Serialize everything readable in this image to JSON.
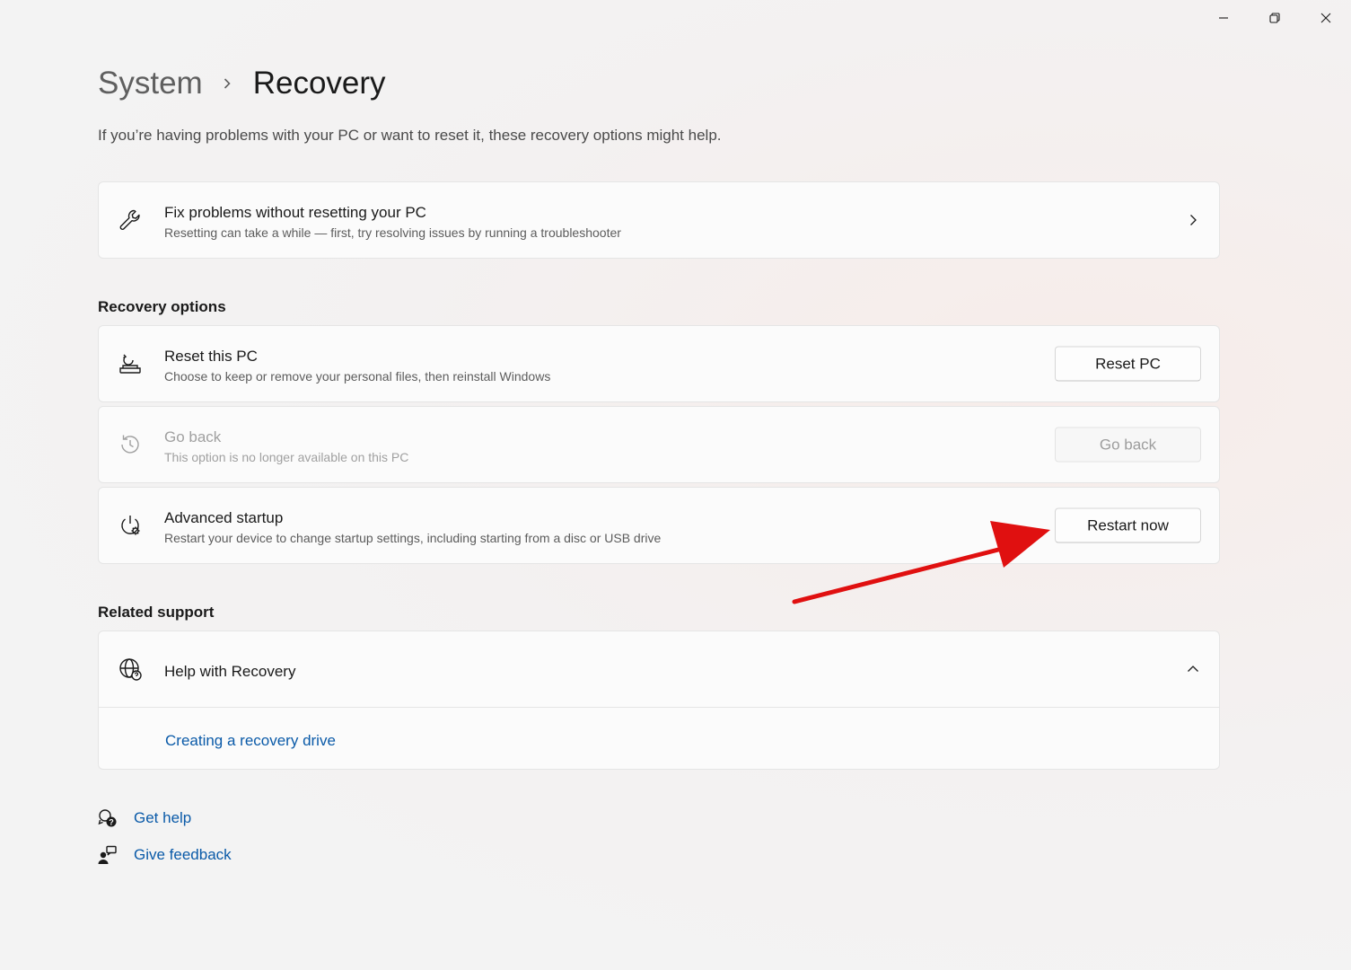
{
  "window": {
    "icons": [
      "minimize-icon",
      "restore-icon",
      "close-icon"
    ]
  },
  "breadcrumb": {
    "parent": "System",
    "current": "Recovery"
  },
  "intro": "If you’re having problems with your PC or want to reset it, these recovery options might help.",
  "fix_card": {
    "icon": "wrench-icon",
    "title": "Fix problems without resetting your PC",
    "subtitle": "Resetting can take a while — first, try resolving issues by running a troubleshooter"
  },
  "recovery_options": {
    "heading": "Recovery options",
    "items": [
      {
        "icon": "reset-pc-icon",
        "title": "Reset this PC",
        "subtitle": "Choose to keep or remove your personal files, then reinstall Windows",
        "button": "Reset PC",
        "enabled": true
      },
      {
        "icon": "history-icon",
        "title": "Go back",
        "subtitle": "This option is no longer available on this PC",
        "button": "Go back",
        "enabled": false
      },
      {
        "icon": "advanced-startup-icon",
        "title": "Advanced startup",
        "subtitle": "Restart your device to change startup settings, including starting from a disc or USB drive",
        "button": "Restart now",
        "enabled": true
      }
    ]
  },
  "related_support": {
    "heading": "Related support",
    "help_title": "Help with Recovery",
    "expanded": true,
    "links": [
      "Creating a recovery drive"
    ]
  },
  "bottom_links": {
    "get_help": "Get help",
    "give_feedback": "Give feedback"
  },
  "annotation": {
    "arrow_color": "#e01010"
  }
}
